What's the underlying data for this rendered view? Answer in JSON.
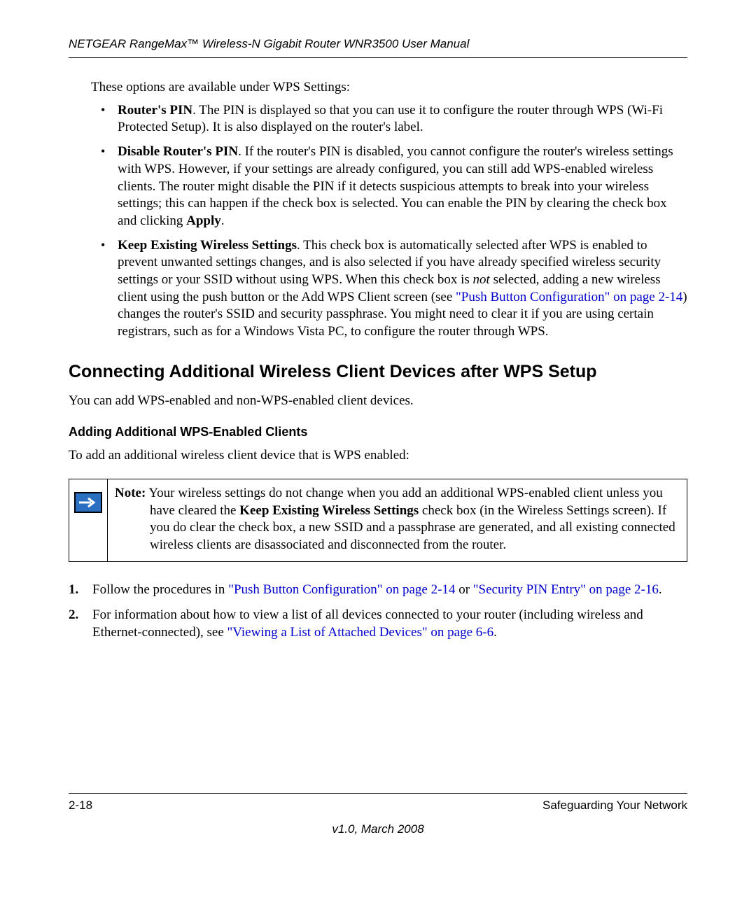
{
  "header": {
    "running": "NETGEAR RangeMax™ Wireless-N Gigabit Router WNR3500 User Manual"
  },
  "intro": "These options are available under WPS Settings:",
  "bullets": {
    "b1": {
      "lead": "Router's PIN",
      "text": ". The PIN is displayed so that you can use it to configure the router through WPS (Wi-Fi Protected Setup). It is also displayed on the router's label."
    },
    "b2": {
      "lead": "Disable Router's PIN",
      "text_a": ". If the router's PIN is disabled, you cannot configure the router's wireless settings with WPS. However, if your settings are already configured, you can still add WPS-enabled wireless clients. The router might disable the PIN if it detects suspicious attempts to break into your wireless settings; this can happen if the check box is selected. You can enable the PIN by clearing the check box and clicking ",
      "apply": "Apply",
      "text_b": "."
    },
    "b3": {
      "lead": "Keep Existing Wireless Settings",
      "text_a": ". This check box is automatically selected after WPS is enabled to prevent unwanted settings changes, and is also selected if you have already specified wireless security settings or your SSID without using WPS. When this check box is ",
      "not": "not",
      "text_b": " selected, adding a new wireless client using the push button or the Add WPS Client screen (see ",
      "link": "\"Push Button Configuration\" on page 2-14",
      "text_c": ") changes the router's SSID and security passphrase. You might need to clear it if you are using certain registrars, such as for a Windows Vista PC, to configure the router through WPS."
    }
  },
  "h2": "Connecting Additional Wireless Client Devices after WPS Setup",
  "p_after_h2": "You can add WPS-enabled and non-WPS-enabled client devices.",
  "h3": "Adding Additional WPS-Enabled Clients",
  "p_after_h3": "To add an additional wireless client device that is WPS enabled:",
  "note": {
    "label": "Note:",
    "text_a": " Your wireless settings do not change when you add an additional WPS-enabled client unless you have cleared the ",
    "bold": "Keep Existing Wireless Settings",
    "text_b": " check box (in the Wireless Settings screen). If you do clear the check box, a new SSID and a passphrase are generated, and all existing connected wireless clients are disassociated and disconnected from the router."
  },
  "steps": {
    "s1": {
      "num": "1.",
      "text_a": "Follow the procedures in ",
      "link1": "\"Push Button Configuration\" on page 2-14",
      "or": " or ",
      "link2": "\"Security PIN Entry\" on page 2-16",
      "text_b": "."
    },
    "s2": {
      "num": "2.",
      "text_a": "For information about how to view a list of all devices connected to your router (including wireless and Ethernet-connected), see ",
      "link": "\"Viewing a List of Attached Devices\" on page 6-6",
      "text_b": "."
    }
  },
  "footer": {
    "page": "2-18",
    "section": "Safeguarding Your Network",
    "version": "v1.0, March 2008"
  }
}
